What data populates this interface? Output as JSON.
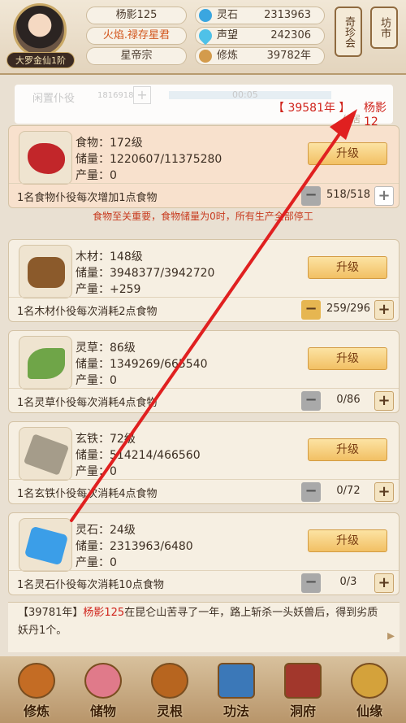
{
  "header": {
    "rank": "大罗金仙1阶",
    "player_name": "杨影125",
    "title": "火焰.禄存星君",
    "sect": "星帝宗",
    "resources": [
      {
        "label": "灵石",
        "value": "2313963",
        "icon": "spirit-stone-icon"
      },
      {
        "label": "声望",
        "value": "242306",
        "icon": "prestige-icon"
      },
      {
        "label": "修炼",
        "value": "39782年",
        "icon": "cultivation-icon"
      }
    ],
    "bazaar": "奇珍会",
    "market": "坊市"
  },
  "notice": {
    "idle_label": "闲置仆役",
    "idle_count": "1816918",
    "time": "00:05",
    "msg_date": "【 39581年 】",
    "msg_name": "杨影12",
    "residence": "仙居"
  },
  "cards": [
    {
      "name": "食物：172级",
      "storage": "储量：1220607/11375280",
      "output": "产量：0",
      "upgrade": "升级",
      "rule": "1名食物仆役每次增加1点食物",
      "ratio": "518/518"
    },
    {
      "name": "木材：148级",
      "storage": "储量：3948377/3942720",
      "output": "产量：+259",
      "upgrade": "升级",
      "rule": "1名木材仆役每次消耗2点食物",
      "ratio": "259/296"
    },
    {
      "name": "灵草：86级",
      "storage": "储量：1349269/665540",
      "output": "产量：0",
      "upgrade": "升级",
      "rule": "1名灵草仆役每次消耗4点食物",
      "ratio": "0/86"
    },
    {
      "name": "玄铁：72级",
      "storage": "储量：514214/466560",
      "output": "产量：0",
      "upgrade": "升级",
      "rule": "1名玄铁仆役每次消耗4点食物",
      "ratio": "0/72"
    },
    {
      "name": "灵石：24级",
      "storage": "储量：2313963/6480",
      "output": "产量：0",
      "upgrade": "升级",
      "rule": "1名灵石仆役每次消耗10点食物",
      "ratio": "0/3"
    }
  ],
  "warning": "食物至关重要，食物储量为0时，所有生产全部停工",
  "log": {
    "date": "【39781年】",
    "name": "杨影125",
    "text": "在昆仑山苦寻了一年，路上斩杀一头妖兽后，得到劣质妖丹1个。"
  },
  "nav": [
    "修炼",
    "储物",
    "灵根",
    "功法",
    "洞府",
    "仙缘"
  ],
  "colors": {
    "accent": "#d0241c",
    "upgrade": "#f2c064",
    "panel": "#f6efe2"
  }
}
